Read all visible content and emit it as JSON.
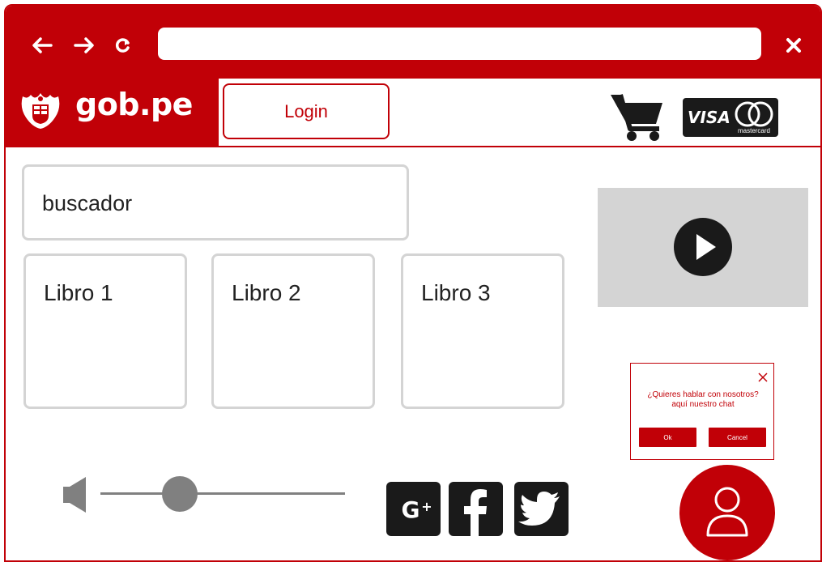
{
  "browser": {
    "back_icon": "arrow-left-icon",
    "forward_icon": "arrow-right-icon",
    "reload_icon": "reload-icon",
    "close_icon": "close-icon",
    "url": ""
  },
  "header": {
    "logo_text": "gob.pe",
    "login_label": "Login",
    "cart_icon": "cart-icon",
    "payment": {
      "visa_text": "VISA",
      "mastercard_text": "mastercard"
    }
  },
  "search": {
    "text": "buscador"
  },
  "books": [
    {
      "label": "Libro 1"
    },
    {
      "label": "Libro 2"
    },
    {
      "label": "Libro 3"
    }
  ],
  "chat": {
    "message": "¿Quieres hablar con nosotros? aquí nuestro chat",
    "ok_label": "Ok",
    "cancel_label": "Cancel"
  },
  "volume": {
    "level": 0.3
  },
  "social": [
    {
      "name": "google-plus-icon",
      "text": "G+"
    },
    {
      "name": "facebook-icon",
      "text": "f"
    },
    {
      "name": "twitter-icon",
      "text": ""
    }
  ],
  "colors": {
    "brand": "#c10007",
    "gray": "#d4d4d4",
    "dark": "#1a1a1a"
  }
}
